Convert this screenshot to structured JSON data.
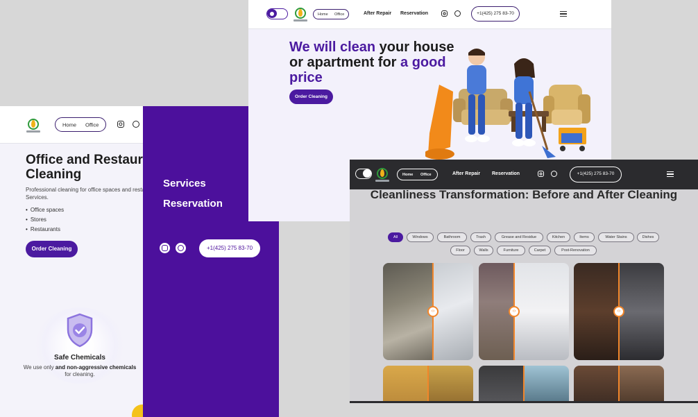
{
  "office_page": {
    "nav": {
      "home": "Home",
      "office": "Office"
    },
    "title": "Office and Restaurant Cleaning",
    "description": "Professional cleaning for office spaces and restaurants by ABA Cleaning Services.",
    "bullets": [
      "Office spaces",
      "Stores",
      "Restaurants"
    ],
    "order_button": "Order Cleaning",
    "feature": {
      "icon": "shield-check-icon",
      "title": "Safe Chemicals",
      "text_before": "We use only ",
      "text_bold": "and non-aggressive chemicals",
      "text_after": " for cleaning."
    }
  },
  "mobile_menu": {
    "items": [
      "Services",
      "Reservation"
    ],
    "phone": "+1(425) 275 83-70",
    "background": "#4c109c"
  },
  "hero_page": {
    "nav": {
      "home": "Home",
      "office": "Office",
      "after_repair": "After Repair",
      "reservation": "Reservation",
      "phone": "+1(425) 275 83-70"
    },
    "title_part1": "We will clean",
    "title_part2": " your house or apartment for ",
    "title_part3": "a good price",
    "order_button": "Order Cleaning",
    "accent": "#4b1aa0"
  },
  "before_after_page": {
    "nav": {
      "home": "Home",
      "office": "Office",
      "after_repair": "After Repair",
      "reservation": "Reservation",
      "phone": "+1(425) 275 83-70"
    },
    "title": "Cleanliness Transformation: Before and After Cleaning",
    "filters_row1": [
      "All",
      "Windows",
      "Bathroom",
      "Trash",
      "Grease and Residue",
      "Kitchen",
      "Items",
      "Water Stains",
      "Dishes"
    ],
    "filters_row2": [
      "Floor",
      "Walls",
      "Furniture",
      "Carpet",
      "Post-Renovation"
    ],
    "active_filter": "All",
    "slider_color": "#f2862a"
  }
}
